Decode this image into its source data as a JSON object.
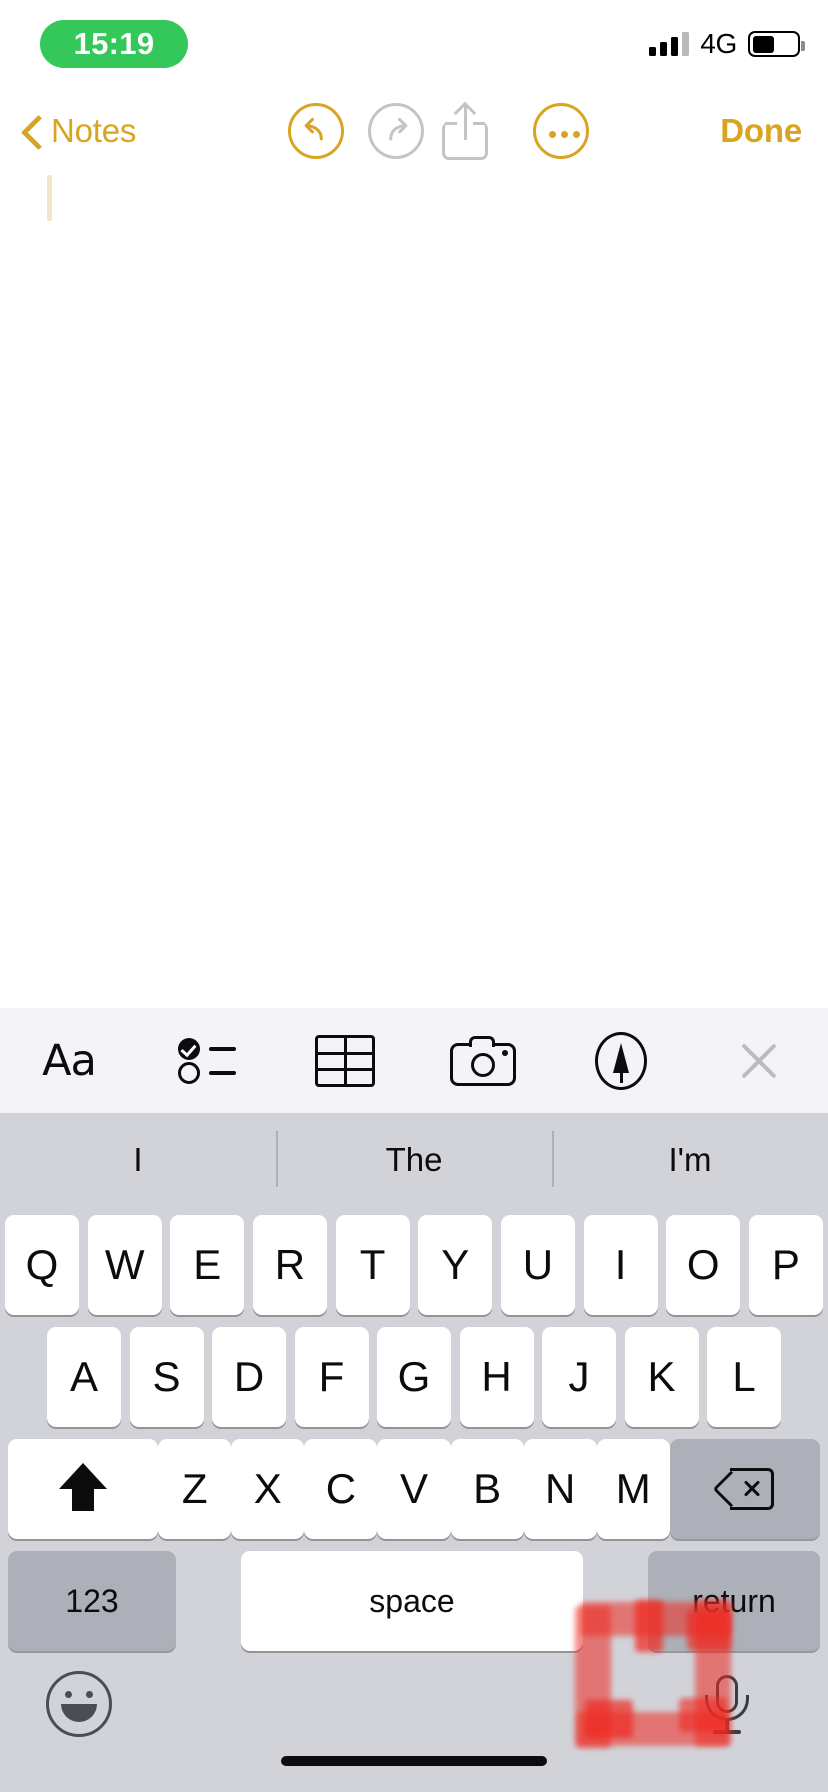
{
  "status_bar": {
    "time": "15:19",
    "time_pill_color": "#34c759",
    "network": "4G",
    "signal_bars_total": 4,
    "signal_bars_filled": 3,
    "battery_percent": 50
  },
  "nav_bar": {
    "back_label": "Notes",
    "back_icon": "chevron-left-icon",
    "undo_icon": "undo-circle-icon",
    "undo_state": "enabled",
    "redo_icon": "redo-circle-icon",
    "redo_state": "disabled",
    "share_icon": "share-up-icon",
    "share_state": "disabled",
    "more_icon": "more-ellipsis-circle-icon",
    "done_label": "Done",
    "accent_color": "#d9a521",
    "disabled_color": "#c4c4c6"
  },
  "note": {
    "body_text": "",
    "caret_color": "#f0e7c8"
  },
  "format_toolbar": {
    "background": "#f4f3f8",
    "items": [
      {
        "name": "format-aa",
        "label": "Aa",
        "icon": "text-format-icon"
      },
      {
        "name": "checklist",
        "label": "",
        "icon": "checklist-icon"
      },
      {
        "name": "table",
        "label": "",
        "icon": "table-icon"
      },
      {
        "name": "camera",
        "label": "",
        "icon": "camera-icon"
      },
      {
        "name": "markup",
        "label": "",
        "icon": "markup-pen-icon"
      },
      {
        "name": "dismiss",
        "label": "",
        "icon": "close-x-icon"
      }
    ]
  },
  "keyboard": {
    "background": "#d1d3d9",
    "predictions": [
      "I",
      "The",
      "I'm"
    ],
    "row1": [
      "Q",
      "W",
      "E",
      "R",
      "T",
      "Y",
      "U",
      "I",
      "O",
      "P"
    ],
    "row2": [
      "A",
      "S",
      "D",
      "F",
      "G",
      "H",
      "J",
      "K",
      "L"
    ],
    "row3": [
      "Z",
      "X",
      "C",
      "V",
      "B",
      "N",
      "M"
    ],
    "shift_icon": "shift-up-arrow-icon",
    "backspace_icon": "backspace-delete-icon",
    "numbers_label": "123",
    "space_label": "space",
    "return_label": "return",
    "emoji_icon": "emoji-smiley-icon",
    "dictation_icon": "microphone-icon"
  },
  "annotation": {
    "shape": "hand-drawn-square",
    "color": "#ef2a21",
    "target": "microphone-icon"
  }
}
